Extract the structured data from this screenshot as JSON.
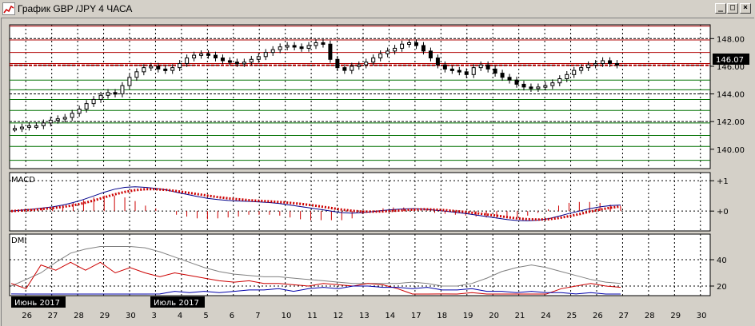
{
  "window": {
    "title": "График GBP /JPY  4 ЧАСА",
    "minimize_glyph": "_",
    "maximize_glyph": "□",
    "close_glyph": "×"
  },
  "colors": {
    "background": "#ffffff",
    "candle": "#000000",
    "resistance_line": "#b00000",
    "support_line": "#007000",
    "macd_line": "#00008b",
    "signal_line": "#cc0000",
    "di_plus": "#0000aa",
    "di_minus": "#cc0000",
    "adx": "#808080"
  },
  "price_panel": {
    "current_price": "146.07",
    "ylim": [
      138.6,
      149.0
    ],
    "y_ticks": [
      "148.00",
      "146.00",
      "144.00",
      "142.00",
      "140.00"
    ],
    "y_values": [
      148,
      146,
      144,
      142,
      140
    ]
  },
  "macd_panel": {
    "label": "MACD",
    "y_ticks": [
      "+1",
      "+0"
    ]
  },
  "dmi_panel": {
    "label": "DMI",
    "y_ticks": [
      "40",
      "20"
    ]
  },
  "x_axis": {
    "day_labels": [
      "26",
      "27",
      "28",
      "29",
      "30",
      "3",
      "4",
      "5",
      "6",
      "7",
      "10",
      "11",
      "12",
      "13",
      "14",
      "17",
      "18",
      "19",
      "20",
      "21",
      "24",
      "25",
      "26",
      "27",
      "28",
      "29",
      "30"
    ],
    "month_markers": [
      "Июнь 2017",
      "Июль 2017"
    ]
  },
  "chart_data": {
    "type": "candlestick",
    "title": "График GBP /JPY  4 ЧАСА",
    "price": [
      141.5,
      141.6,
      141.7,
      141.7,
      141.9,
      142.1,
      142.2,
      142.3,
      142.6,
      142.9,
      143.3,
      143.6,
      143.9,
      144.1,
      144.0,
      144.6,
      145.2,
      145.6,
      145.9,
      146.0,
      145.8,
      145.7,
      145.9,
      146.2,
      146.6,
      146.8,
      146.9,
      146.8,
      146.6,
      146.4,
      146.3,
      146.2,
      146.3,
      146.5,
      146.7,
      147.0,
      147.2,
      147.4,
      147.5,
      147.4,
      147.3,
      147.5,
      147.7,
      147.6,
      146.5,
      145.9,
      145.7,
      146.0,
      146.1,
      146.3,
      146.6,
      146.9,
      147.1,
      147.3,
      147.6,
      147.7,
      147.5,
      147.1,
      146.6,
      146.1,
      145.8,
      145.7,
      145.6,
      145.4,
      145.9,
      146.1,
      145.8,
      145.5,
      145.2,
      145.0,
      144.7,
      144.5,
      144.4,
      144.5,
      144.6,
      144.8,
      145.1,
      145.4,
      145.7,
      145.9,
      146.1,
      146.2,
      146.4,
      146.2,
      146.1
    ],
    "resistance_levels": [
      148.9,
      147.9,
      147.0,
      146.2
    ],
    "support_levels": [
      145.0,
      144.3,
      143.6,
      142.8,
      141.9,
      141.0,
      140.2,
      139.2
    ],
    "dashed_levels": [
      148.0,
      146.07,
      144.0,
      142.0
    ],
    "macd": [
      0.0,
      0.03,
      0.06,
      0.1,
      0.14,
      0.2,
      0.28,
      0.38,
      0.5,
      0.62,
      0.72,
      0.78,
      0.8,
      0.78,
      0.75,
      0.7,
      0.62,
      0.55,
      0.48,
      0.42,
      0.38,
      0.35,
      0.33,
      0.32,
      0.3,
      0.28,
      0.25,
      0.2,
      0.15,
      0.1,
      0.05,
      0.0,
      -0.05,
      -0.07,
      -0.05,
      -0.02,
      0.02,
      0.05,
      0.07,
      0.08,
      0.06,
      0.03,
      0.0,
      -0.04,
      -0.08,
      -0.13,
      -0.18,
      -0.23,
      -0.28,
      -0.31,
      -0.32,
      -0.3,
      -0.25,
      -0.17,
      -0.08,
      0.0,
      0.08,
      0.14,
      0.18,
      0.2
    ],
    "signal": [
      0.0,
      0.02,
      0.04,
      0.07,
      0.1,
      0.14,
      0.19,
      0.26,
      0.35,
      0.45,
      0.55,
      0.63,
      0.69,
      0.72,
      0.72,
      0.7,
      0.66,
      0.61,
      0.56,
      0.51,
      0.46,
      0.42,
      0.39,
      0.36,
      0.34,
      0.32,
      0.3,
      0.27,
      0.24,
      0.2,
      0.15,
      0.1,
      0.05,
      0.01,
      -0.02,
      -0.02,
      -0.01,
      0.01,
      0.03,
      0.05,
      0.06,
      0.05,
      0.03,
      0.0,
      -0.03,
      -0.07,
      -0.11,
      -0.15,
      -0.2,
      -0.24,
      -0.27,
      -0.28,
      -0.27,
      -0.23,
      -0.17,
      -0.1,
      -0.02,
      0.05,
      0.11,
      0.15
    ],
    "adx": [
      20,
      25,
      30,
      38,
      45,
      48,
      50,
      50,
      50,
      49,
      46,
      42,
      38,
      34,
      31,
      29,
      28,
      27,
      27,
      26,
      25,
      24,
      23,
      22,
      22,
      22,
      22,
      23,
      22,
      20,
      20,
      22,
      26,
      31,
      34,
      36,
      34,
      31,
      28,
      25,
      23,
      22
    ],
    "di_plus": [
      14,
      13,
      12,
      9,
      8,
      8,
      8,
      7,
      7,
      10,
      14,
      16,
      15,
      16,
      15,
      16,
      17,
      17,
      18,
      16,
      18,
      19,
      18,
      20,
      20,
      19,
      19,
      18,
      19,
      17,
      17,
      18,
      16,
      16,
      15,
      16,
      15,
      15,
      14,
      15,
      13,
      12
    ],
    "di_minus": [
      22,
      18,
      36,
      32,
      38,
      32,
      38,
      30,
      34,
      30,
      27,
      30,
      28,
      26,
      24,
      23,
      24,
      22,
      22,
      21,
      20,
      22,
      21,
      20,
      22,
      21,
      18,
      13,
      12,
      14,
      13,
      15,
      10,
      11,
      9,
      10,
      12,
      18,
      20,
      22,
      20,
      19
    ]
  }
}
